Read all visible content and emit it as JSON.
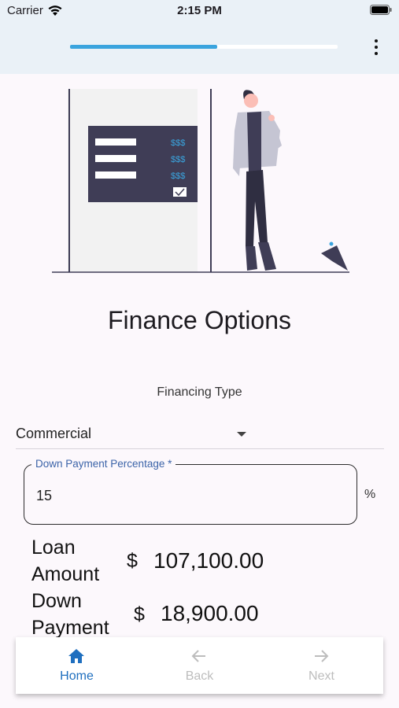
{
  "status": {
    "carrier": "Carrier",
    "time": "2:15 PM"
  },
  "progress": {
    "fraction": 0.55,
    "fill_color": "#3aa4de"
  },
  "illustration": {
    "price_labels": [
      "$$$",
      "$$$",
      "$$$"
    ]
  },
  "page": {
    "title": "Finance Options"
  },
  "financing": {
    "label": "Financing Type",
    "selected": "Commercial"
  },
  "down_payment": {
    "label": "Down Payment Percentage *",
    "value": "15",
    "suffix": "%"
  },
  "loan": {
    "label_line1": "Loan",
    "label_line2": "Amount",
    "currency": "$",
    "value": "107,100.00"
  },
  "payment": {
    "label_line1": "Down",
    "label_line2": "Payment",
    "currency": "$",
    "value": "18,900.00"
  },
  "nav": {
    "home": {
      "label": "Home",
      "icon": "home-icon"
    },
    "back": {
      "label": "Back",
      "icon": "arrow-left-icon"
    },
    "next": {
      "label": "Next",
      "icon": "arrow-right-icon"
    }
  },
  "colors": {
    "accent": "#3aa4de",
    "nav_active": "#1f6fbf",
    "appbar": "#eaf1f7"
  }
}
